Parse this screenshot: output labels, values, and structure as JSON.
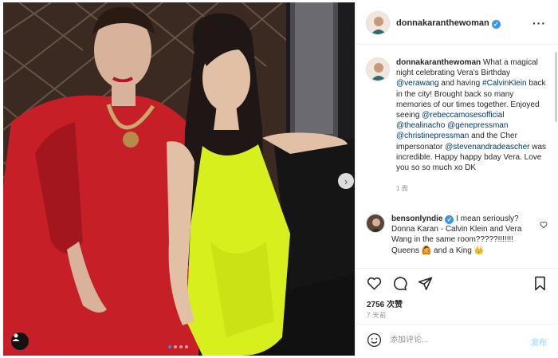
{
  "photo": {
    "alt": "",
    "next_icon": "chevron-right-icon",
    "user_tag_icon": "person-icon",
    "carousel_count": 4,
    "carousel_active": 1
  },
  "header": {
    "username": "donnakaranthewoman",
    "verified": true,
    "more_icon": "more-horizontal-icon",
    "more_label": "···"
  },
  "caption": {
    "username": "donnakaranthewoman",
    "segments": [
      {
        "t": " What a magical night celebrating Vera's Birthday ",
        "link": false
      },
      {
        "t": "@verawang",
        "link": true
      },
      {
        "t": " and having ",
        "link": false
      },
      {
        "t": "#CalvinKlein",
        "link": true
      },
      {
        "t": " back in the city! Brought back so many memories of our times together. Enjoyed seeing ",
        "link": false
      },
      {
        "t": "@rebeccamosesofficial",
        "link": true
      },
      {
        "t": " ",
        "link": false
      },
      {
        "t": "@thealinacho",
        "link": true
      },
      {
        "t": " ",
        "link": false
      },
      {
        "t": "@genepressman",
        "link": true
      },
      {
        "t": " ",
        "link": false
      },
      {
        "t": "@christinepressman",
        "link": true
      },
      {
        "t": " and the Cher impersonator ",
        "link": false
      },
      {
        "t": "@stevenandradeascher",
        "link": true
      },
      {
        "t": " was incredible. Happy happy bday Vera. Love you so so much xo DK",
        "link": false
      }
    ],
    "time": "1 周"
  },
  "comment": {
    "username": "bensonlyndie",
    "verified": true,
    "text": " I mean seriously? Donna Karan - Calvin Klein and Vera Wang in the same room?????!!!!!!! Queens 🙆 and a King 👑",
    "like_icon": "heart-outline-icon"
  },
  "actions": {
    "like_icon": "heart-icon",
    "comment_icon": "comment-icon",
    "share_icon": "send-icon",
    "save_icon": "bookmark-icon",
    "likes": "2756 次赞",
    "time": "7 天前"
  },
  "comment_box": {
    "emoji_icon": "smiley-icon",
    "placeholder": "添加评论...",
    "post_label": "发布"
  },
  "colors": {
    "link": "#00376b",
    "verified": "#3897f0",
    "post_disabled": "#b2dffc",
    "muted": "#8e8e8e"
  }
}
